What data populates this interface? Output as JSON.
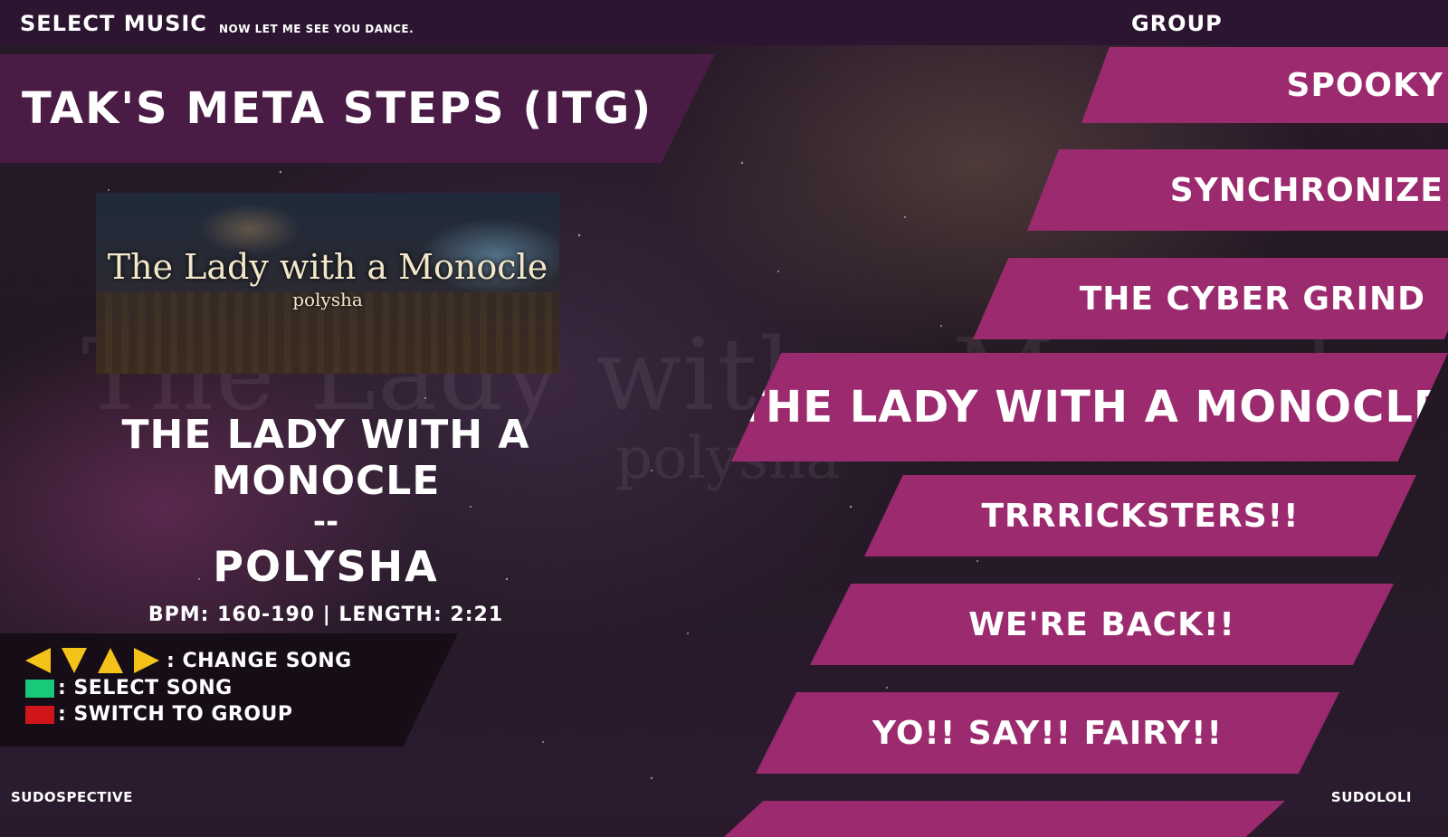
{
  "header": {
    "title": "SELECT MUSIC",
    "subtitle": "NOW LET ME SEE YOU DANCE.",
    "group_label": "GROUP"
  },
  "group_banner": "TAK'S META STEPS (ITG)",
  "song_art": {
    "title": "The Lady with a Monocle",
    "artist": "polysha"
  },
  "song_info": {
    "title": "THE LADY WITH A MONOCLE",
    "separator": "--",
    "artist": "POLYSHA",
    "meta": "BPM: 160-190 | LENGTH: 2:21"
  },
  "controls": {
    "change_song": ": CHANGE SONG",
    "select_song": ": SELECT SONG",
    "switch_group": ": SWITCH TO GROUP",
    "arrow_color": "#f5c21a",
    "select_color": "#19c97a",
    "switch_color": "#d0161a"
  },
  "song_wheel": [
    {
      "label": "SPOOKY",
      "selected": false
    },
    {
      "label": "SYNCHRONIZE",
      "selected": false
    },
    {
      "label": "THE CYBER GRIND",
      "selected": false
    },
    {
      "label": "THE LADY WITH A MONOCLE",
      "selected": true
    },
    {
      "label": "TRRRICKSTERS!!",
      "selected": false
    },
    {
      "label": "WE'RE BACK!!",
      "selected": false
    },
    {
      "label": "YO!! SAY!! FAIRY!!",
      "selected": false
    },
    {
      "label": "",
      "selected": false
    }
  ],
  "footer": {
    "left": "SUDOSPECTIVE",
    "right": "SUDOLOLI"
  },
  "colors": {
    "wheel_item": "#9c2a6e",
    "banner": "#4a1c45",
    "topbar": "#2c1530"
  }
}
